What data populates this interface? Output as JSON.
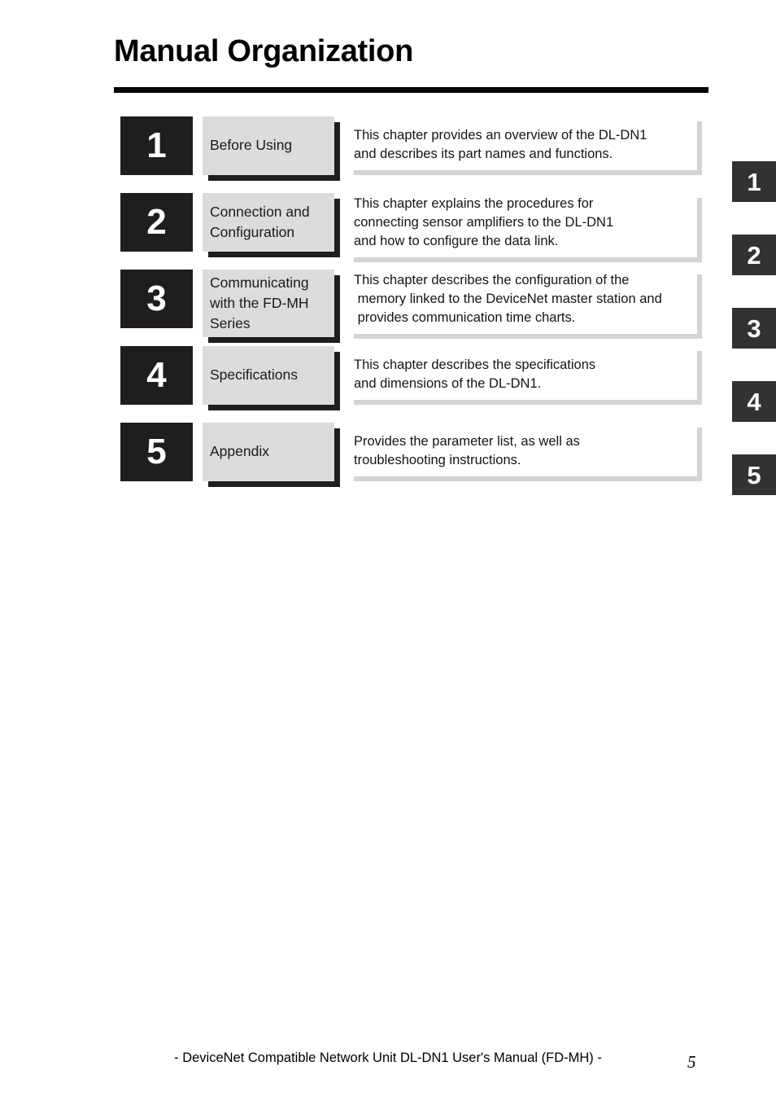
{
  "page": {
    "title": "Manual Organization",
    "number": "5",
    "footer_note": "- DeviceNet Compatible Network Unit DL-DN1 User's Manual (FD-MH) -"
  },
  "colors": {
    "number_box": "#201d1d",
    "title_plate": "#dcdcdc",
    "title_plate_shadow": "#201d1d",
    "description_panel": "#ffffff",
    "description_shadow": "#d4d4d4",
    "side_tab": "#333233",
    "rule": "#000000",
    "text": "#000000"
  },
  "chapters": [
    {
      "number": "1",
      "title_lines": [
        "Before Using"
      ],
      "description_lines": [
        "This chapter provides an overview of the DL-DN1",
        "and describes its part names and functions."
      ]
    },
    {
      "number": "2",
      "title_lines": [
        "Connection and",
        "Configuration"
      ],
      "description_lines": [
        "This chapter explains the procedures for",
        "connecting sensor amplifiers to the DL-DN1",
        "and how to configure the data link."
      ]
    },
    {
      "number": "3",
      "title_lines": [
        "Communicating",
        "with the FD-MH",
        "Series"
      ],
      "description_lines": [
        "This chapter describes the configuration of the",
        " memory linked to the DeviceNet master station and",
        " provides communication time charts."
      ]
    },
    {
      "number": "4",
      "title_lines": [
        "Specifications"
      ],
      "description_lines": [
        "This chapter describes the specifications",
        "and dimensions of the DL-DN1."
      ]
    },
    {
      "number": "5",
      "title_lines": [
        "Appendix"
      ],
      "description_lines": [
        "Provides the parameter list, as well as",
        "troubleshooting instructions."
      ]
    }
  ],
  "side_tabs": [
    {
      "label": "1"
    },
    {
      "label": "2"
    },
    {
      "label": "3"
    },
    {
      "label": "4"
    },
    {
      "label": "5"
    }
  ]
}
